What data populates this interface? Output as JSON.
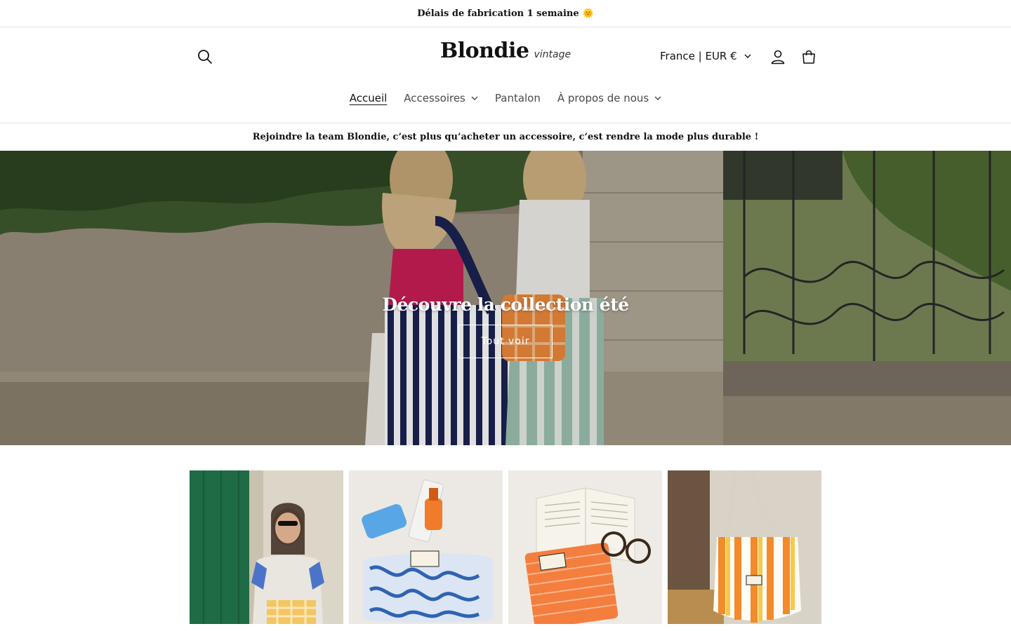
{
  "announcement": {
    "text": "Délais de fabrication 1 semaine",
    "emoji": "🌞"
  },
  "header": {
    "logo_main": "Blondie",
    "logo_sub": "vintage",
    "country_selector": "France | EUR €",
    "icons": [
      "search-icon",
      "account-icon",
      "cart-icon",
      "chevron-down-icon"
    ]
  },
  "nav": {
    "items": [
      {
        "label": "Accueil",
        "active": true,
        "has_dropdown": false
      },
      {
        "label": "Accessoires",
        "active": false,
        "has_dropdown": true
      },
      {
        "label": "Pantalon",
        "active": false,
        "has_dropdown": false
      },
      {
        "label": "À propos de nous",
        "active": false,
        "has_dropdown": true
      }
    ]
  },
  "tagline": "Rejoindre la team Blondie, c’est plus qu’acheter un accessoire, c’est rendre la mode plus durable !",
  "hero": {
    "title": "Découvre la collection été",
    "button_label": "Tout voir"
  },
  "colors": {
    "text": "#121212",
    "border": "#e6e6e6",
    "hero_text": "#ffffff"
  }
}
